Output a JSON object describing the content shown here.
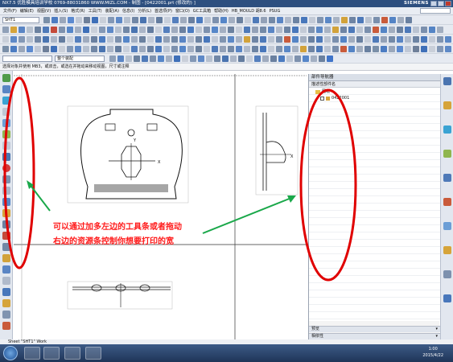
{
  "titlebar": {
    "title": "NX7.5  优胜模具培训学校  0769-88031860  WWW.MIZL.COM - 制图 - [0422001.prt (修改的) ]",
    "brand": "SIEMENS"
  },
  "menubar": {
    "items": [
      "文件(F)",
      "编辑(E)",
      "视图(V)",
      "插入(S)",
      "格式(R)",
      "工具(T)",
      "装配(A)",
      "信息(I)",
      "分析(L)",
      "首选项(P)",
      "窗口(O)",
      "GC工具箱",
      "帮助(H)",
      "HB_MOULD 胡8.6",
      "PSUG"
    ]
  },
  "toolbar": {
    "sheet_select": "SHT1",
    "assembly_filter": "整个装配"
  },
  "statusline": {
    "prompt": "选择对象并使用 MB3，或双击，或选在并拖动来移动视图，尺寸或注释"
  },
  "drawing": {
    "label_x": "X",
    "label_y": "Y"
  },
  "resource": {
    "header": "部件导航器",
    "column": "描述性部件名",
    "tree": [
      {
        "label": "图纸"
      },
      {
        "label": "0422001"
      }
    ],
    "bottom_bars": [
      "预览",
      "相依性"
    ]
  },
  "annotation": {
    "line1": "可以通过加多左边的工具条或者拖动",
    "line2": "右边的资源条控制你想要打印的宽",
    "color": "#ff1a1a"
  },
  "sheet_status": "Sheet \"SHT1\" Work",
  "taskbar": {
    "time": "1:00",
    "date": "2015/4/22"
  }
}
